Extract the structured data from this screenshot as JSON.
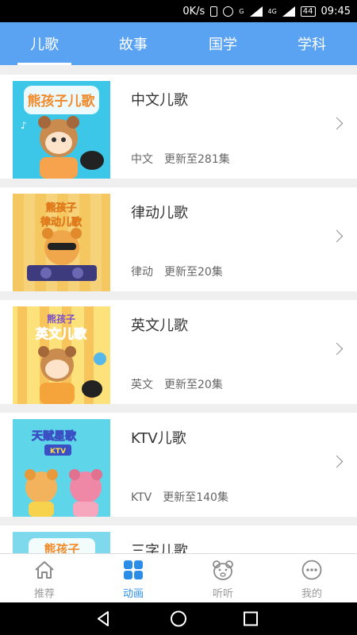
{
  "status_bar": {
    "net_speed": "0K/s",
    "signal": "G",
    "network": "4G",
    "battery": "44",
    "time": "09:45"
  },
  "tabs": [
    {
      "label": "儿歌",
      "active": true
    },
    {
      "label": "故事",
      "active": false
    },
    {
      "label": "国学",
      "active": false
    },
    {
      "label": "学科",
      "active": false
    }
  ],
  "cards": [
    {
      "title": "中文儿歌",
      "tag": "中文",
      "update": "更新至281集",
      "art_text": "熊孩子儿歌",
      "colors": {
        "bg": "#3cc7e8",
        "accent": "#f7a24d"
      }
    },
    {
      "title": "律动儿歌",
      "tag": "律动",
      "update": "更新至20集",
      "art_text": "熊孩子律动儿歌",
      "colors": {
        "bg": "#f6d37a",
        "accent": "#f2b133"
      }
    },
    {
      "title": "英文儿歌",
      "tag": "英文",
      "update": "更新至20集",
      "art_text": "熊孩子英文儿歌",
      "colors": {
        "bg": "#fde17a",
        "accent": "#f4a43a"
      }
    },
    {
      "title": "KTV儿歌",
      "tag": "KTV",
      "update": "更新至140集",
      "art_text": "天赋星歌 KTV",
      "colors": {
        "bg": "#5fd5ea",
        "accent": "#ef88a6"
      }
    },
    {
      "title": "三字儿歌",
      "tag": "",
      "update": "",
      "art_text": "熊孩子",
      "colors": {
        "bg": "#7fd9ec",
        "accent": "#f7a24d"
      }
    }
  ],
  "bottom_nav": [
    {
      "label": "推荐",
      "icon": "home-icon",
      "active": false
    },
    {
      "label": "动画",
      "icon": "grid-icon",
      "active": true
    },
    {
      "label": "听听",
      "icon": "bear-icon",
      "active": false
    },
    {
      "label": "我的",
      "icon": "more-icon",
      "active": false
    }
  ],
  "colors": {
    "header": "#5aa2f2",
    "active_nav": "#2b8de6",
    "inactive_nav": "#999999"
  }
}
